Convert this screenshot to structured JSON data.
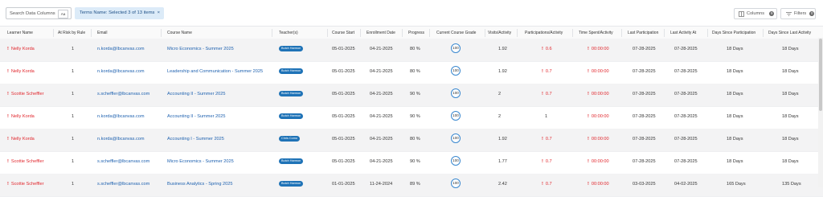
{
  "toolbar": {
    "search_placeholder": "Search Data Columns",
    "search_case_toggle": "Aa",
    "filter_chip": "Terms Name: Selected 3 of 13 items",
    "chip_close": "×",
    "columns_label": "Columns",
    "columns_count": "9",
    "filters_label": "Filters",
    "filters_count": "0"
  },
  "columns": [
    "Learner Name",
    "At Risk by Rule",
    "Email",
    "Course Name",
    "Teacher(s)",
    "Course Start",
    "Enrollment Date",
    "Progress",
    "Current Course Grade",
    "Visits/Activity",
    "Participations/Activity",
    "Time Spent/Activity",
    "Last Participation",
    "Last Activity At",
    "Days Since Participation",
    "Days Since Last Activity"
  ],
  "rows": [
    {
      "name": "Nelly Korda",
      "risk": "1",
      "email": "n.korda@lbcanvas.com",
      "course": "Micro Economics - Summer 2025",
      "teacher": "Butch Harmon",
      "start": "05-01-2025",
      "enroll": "04-21-2025",
      "progress": "80 %",
      "grade": "100",
      "visits": "1.92",
      "part": "0.6",
      "part_flag": true,
      "time": "00:00:00",
      "last_part": "07-28-2025",
      "last_act": "07-28-2025",
      "days_part": "18 Days",
      "days_act": "18 Days"
    },
    {
      "name": "Nelly Korda",
      "risk": "1",
      "email": "n.korda@lbcanvas.com",
      "course": "Leadership and Communication - Summer 2025",
      "teacher": "Butch Harmon",
      "start": "05-01-2025",
      "enroll": "04-21-2025",
      "progress": "80 %",
      "grade": "100",
      "visits": "1.92",
      "part": "0.7",
      "part_flag": true,
      "time": "00:00:00",
      "last_part": "07-28-2025",
      "last_act": "07-28-2025",
      "days_part": "18 Days",
      "days_act": "18 Days"
    },
    {
      "name": "Scottie Scheffler",
      "risk": "1",
      "email": "s.scheffler@lbcanvas.com",
      "course": "Accounting II - Summer 2025",
      "teacher": "Butch Harmon",
      "start": "05-01-2025",
      "enroll": "04-21-2025",
      "progress": "90 %",
      "grade": "100",
      "visits": "2",
      "part": "0.7",
      "part_flag": true,
      "time": "00:00:00",
      "last_part": "07-28-2025",
      "last_act": "07-28-2025",
      "days_part": "18 Days",
      "days_act": "18 Days"
    },
    {
      "name": "Nelly Korda",
      "risk": "1",
      "email": "n.korda@lbcanvas.com",
      "course": "Accounting II - Summer 2025",
      "teacher": "Butch Harmon",
      "start": "05-01-2025",
      "enroll": "04-21-2025",
      "progress": "90 %",
      "grade": "100",
      "visits": "2",
      "part": "1",
      "part_flag": false,
      "time": "00:00:00",
      "last_part": "07-28-2025",
      "last_act": "07-28-2025",
      "days_part": "18 Days",
      "days_act": "18 Days"
    },
    {
      "name": "Nelly Korda",
      "risk": "1",
      "email": "n.korda@lbcanvas.com",
      "course": "Accounting I - Summer 2025",
      "teacher": "Chris Como",
      "start": "05-01-2025",
      "enroll": "04-21-2025",
      "progress": "80 %",
      "grade": "100",
      "visits": "1.92",
      "part": "0.7",
      "part_flag": true,
      "time": "00:00:00",
      "last_part": "07-28-2025",
      "last_act": "07-28-2025",
      "days_part": "18 Days",
      "days_act": "18 Days"
    },
    {
      "name": "Scottie Scheffler",
      "risk": "1",
      "email": "s.scheffler@lbcanvas.com",
      "course": "Micro Economics - Summer 2025",
      "teacher": "Butch Harmon",
      "start": "05-01-2025",
      "enroll": "04-21-2025",
      "progress": "90 %",
      "grade": "100",
      "visits": "1.77",
      "part": "0.7",
      "part_flag": true,
      "time": "00:00:00",
      "last_part": "07-28-2025",
      "last_act": "07-28-2025",
      "days_part": "18 Days",
      "days_act": "18 Days"
    },
    {
      "name": "Scottie Scheffler",
      "risk": "1",
      "email": "s.scheffler@lbcanvas.com",
      "course": "Business Analytics - Spring 2025",
      "teacher": "Butch Harmon",
      "start": "01-01-2025",
      "enroll": "11-24-2024",
      "progress": "89 %",
      "grade": "100",
      "visits": "2.42",
      "part": "0.7",
      "part_flag": true,
      "time": "00:00:00",
      "last_part": "03-03-2025",
      "last_act": "04-02-2025",
      "days_part": "165 Days",
      "days_act": "135 Days"
    }
  ],
  "colors": {
    "danger": "#e1272d",
    "link": "#1f62b0",
    "badge": "#1f73b7",
    "grade_ring": "#3a88cf",
    "chip_bg": "#dcebf8"
  },
  "icons": [
    "columns-icon",
    "filter-icon",
    "sort-icon",
    "close-icon",
    "alert-icon"
  ]
}
